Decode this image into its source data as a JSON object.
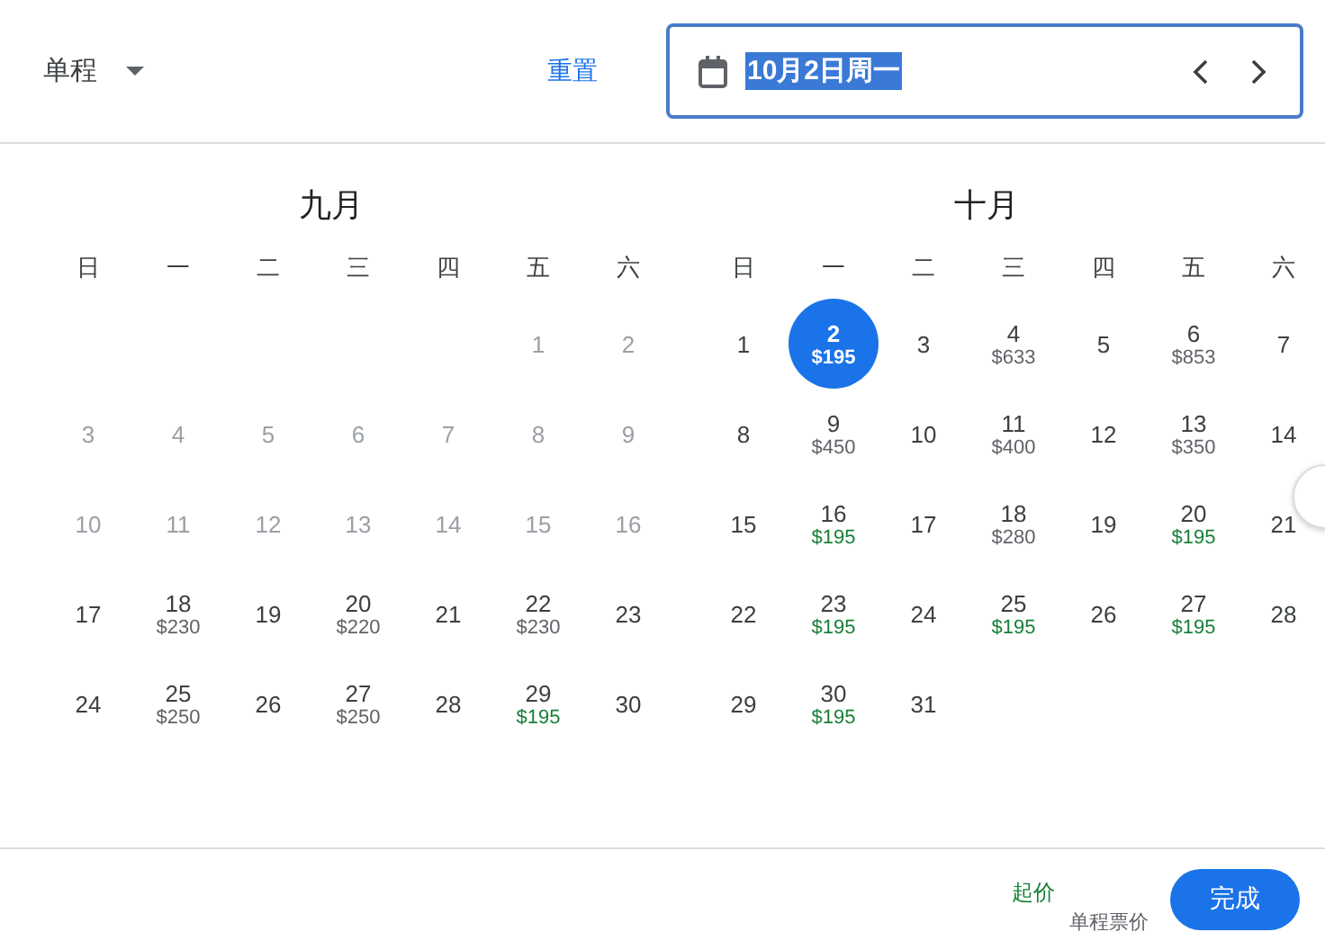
{
  "trip_type": {
    "label": "单程"
  },
  "reset": "重置",
  "date_field": {
    "value": "10月2日周一",
    "text_selected": true
  },
  "months": [
    {
      "title": "九月",
      "weekdays": [
        "日",
        "一",
        "二",
        "三",
        "四",
        "五",
        "六"
      ],
      "weeks": [
        [
          {
            "day": "1",
            "disabled": true,
            "selected": false
          },
          {
            "day": "2",
            "disabled": true,
            "selected": false
          }
        ],
        [
          {
            "day": "3",
            "disabled": true,
            "selected": false
          },
          {
            "day": "4",
            "disabled": true,
            "selected": false
          },
          {
            "day": "5",
            "disabled": true,
            "selected": false
          },
          {
            "day": "6",
            "disabled": true,
            "selected": false
          },
          {
            "day": "7",
            "disabled": true,
            "selected": false
          },
          {
            "day": "8",
            "disabled": true,
            "selected": false
          },
          {
            "day": "9",
            "disabled": true,
            "selected": false
          }
        ],
        [
          {
            "day": "10",
            "disabled": true,
            "selected": false
          },
          {
            "day": "11",
            "disabled": true,
            "selected": false
          },
          {
            "day": "12",
            "disabled": true,
            "selected": false
          },
          {
            "day": "13",
            "disabled": true,
            "selected": false
          },
          {
            "day": "14",
            "disabled": true,
            "selected": false
          },
          {
            "day": "15",
            "disabled": true,
            "selected": false
          },
          {
            "day": "16",
            "disabled": true,
            "selected": false
          }
        ],
        [
          {
            "day": "17",
            "disabled": false,
            "selected": false
          },
          {
            "day": "18",
            "price": "$230",
            "cheap": false,
            "disabled": false,
            "selected": false
          },
          {
            "day": "19",
            "disabled": false,
            "selected": false
          },
          {
            "day": "20",
            "price": "$220",
            "cheap": false,
            "disabled": false,
            "selected": false
          },
          {
            "day": "21",
            "disabled": false,
            "selected": false
          },
          {
            "day": "22",
            "price": "$230",
            "cheap": false,
            "disabled": false,
            "selected": false
          },
          {
            "day": "23",
            "disabled": false,
            "selected": false
          }
        ],
        [
          {
            "day": "24",
            "disabled": false,
            "selected": false
          },
          {
            "day": "25",
            "price": "$250",
            "cheap": false,
            "disabled": false,
            "selected": false
          },
          {
            "day": "26",
            "disabled": false,
            "selected": false
          },
          {
            "day": "27",
            "price": "$250",
            "cheap": false,
            "disabled": false,
            "selected": false
          },
          {
            "day": "28",
            "disabled": false,
            "selected": false
          },
          {
            "day": "29",
            "price": "$195",
            "cheap": true,
            "disabled": false,
            "selected": false
          },
          {
            "day": "30",
            "disabled": false,
            "selected": false
          }
        ]
      ]
    },
    {
      "title": "十月",
      "weekdays": [
        "日",
        "一",
        "二",
        "三",
        "四",
        "五",
        "六"
      ],
      "weeks": [
        [
          {
            "day": "1",
            "disabled": false,
            "selected": false
          },
          {
            "day": "2",
            "price": "$195",
            "cheap": true,
            "disabled": false,
            "selected": true
          },
          {
            "day": "3",
            "disabled": false,
            "selected": false
          },
          {
            "day": "4",
            "price": "$633",
            "cheap": false,
            "disabled": false,
            "selected": false
          },
          {
            "day": "5",
            "disabled": false,
            "selected": false
          },
          {
            "day": "6",
            "price": "$853",
            "cheap": false,
            "disabled": false,
            "selected": false
          },
          {
            "day": "7",
            "disabled": false,
            "selected": false
          }
        ],
        [
          {
            "day": "8",
            "disabled": false,
            "selected": false
          },
          {
            "day": "9",
            "price": "$450",
            "cheap": false,
            "disabled": false,
            "selected": false
          },
          {
            "day": "10",
            "disabled": false,
            "selected": false
          },
          {
            "day": "11",
            "price": "$400",
            "cheap": false,
            "disabled": false,
            "selected": false
          },
          {
            "day": "12",
            "disabled": false,
            "selected": false
          },
          {
            "day": "13",
            "price": "$350",
            "cheap": false,
            "disabled": false,
            "selected": false
          },
          {
            "day": "14",
            "disabled": false,
            "selected": false
          }
        ],
        [
          {
            "day": "15",
            "disabled": false,
            "selected": false
          },
          {
            "day": "16",
            "price": "$195",
            "cheap": true,
            "disabled": false,
            "selected": false
          },
          {
            "day": "17",
            "disabled": false,
            "selected": false
          },
          {
            "day": "18",
            "price": "$280",
            "cheap": false,
            "disabled": false,
            "selected": false
          },
          {
            "day": "19",
            "disabled": false,
            "selected": false
          },
          {
            "day": "20",
            "price": "$195",
            "cheap": true,
            "disabled": false,
            "selected": false
          },
          {
            "day": "21",
            "disabled": false,
            "selected": false
          }
        ],
        [
          {
            "day": "22",
            "disabled": false,
            "selected": false
          },
          {
            "day": "23",
            "price": "$195",
            "cheap": true,
            "disabled": false,
            "selected": false
          },
          {
            "day": "24",
            "disabled": false,
            "selected": false
          },
          {
            "day": "25",
            "price": "$195",
            "cheap": true,
            "disabled": false,
            "selected": false
          },
          {
            "day": "26",
            "disabled": false,
            "selected": false
          },
          {
            "day": "27",
            "price": "$195",
            "cheap": true,
            "disabled": false,
            "selected": false
          },
          {
            "day": "28",
            "disabled": false,
            "selected": false
          }
        ],
        [
          {
            "day": "29",
            "disabled": false,
            "selected": false
          },
          {
            "day": "30",
            "price": "$195",
            "cheap": true,
            "disabled": false,
            "selected": false
          },
          {
            "day": "31",
            "disabled": false,
            "selected": false
          }
        ]
      ]
    }
  ],
  "footer": {
    "from_label": "起价",
    "fare_note": "单程票价",
    "done": "完成"
  }
}
